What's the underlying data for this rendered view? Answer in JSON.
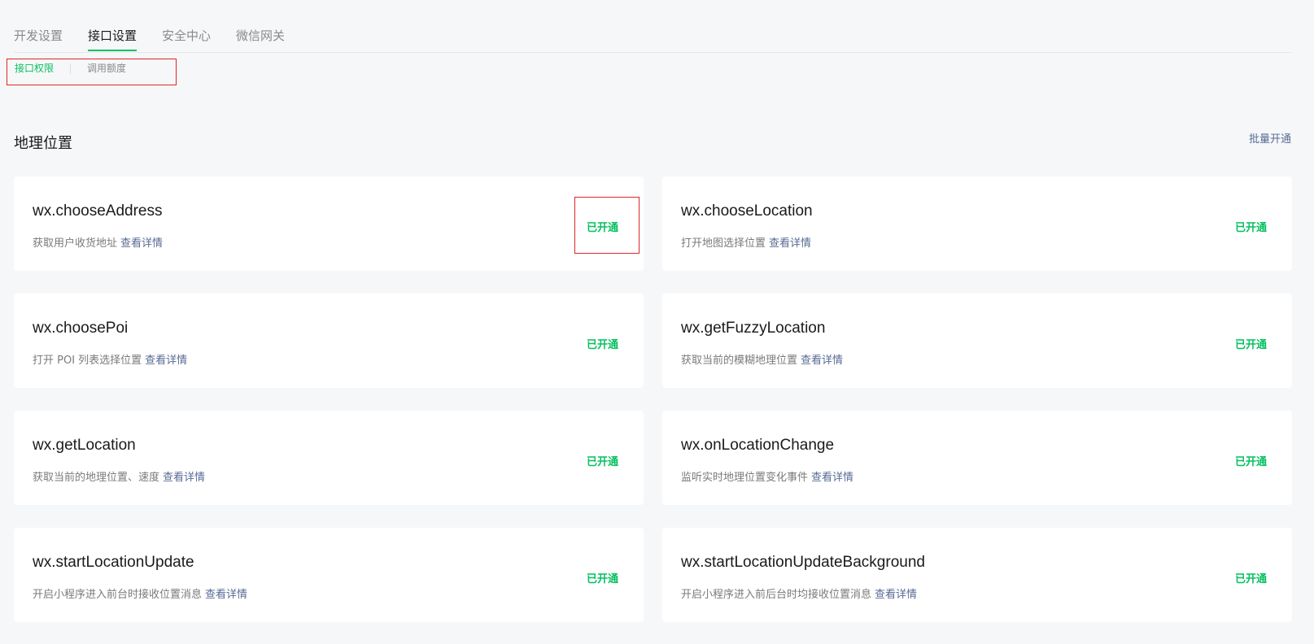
{
  "tabs": [
    "开发设置",
    "接口设置",
    "安全中心",
    "微信网关"
  ],
  "active_tab_index": 1,
  "subtabs": [
    "接口权限",
    "调用额度"
  ],
  "active_subtab_index": 0,
  "section": {
    "title": "地理位置",
    "batch_label": "批量开通"
  },
  "detail_label": "查看详情",
  "apis": [
    {
      "name": "wx.chooseAddress",
      "desc": "获取用户收货地址",
      "status": "已开通"
    },
    {
      "name": "wx.chooseLocation",
      "desc": "打开地图选择位置",
      "status": "已开通"
    },
    {
      "name": "wx.choosePoi",
      "desc": "打开 POI 列表选择位置",
      "status": "已开通"
    },
    {
      "name": "wx.getFuzzyLocation",
      "desc": "获取当前的模糊地理位置",
      "status": "已开通"
    },
    {
      "name": "wx.getLocation",
      "desc": "获取当前的地理位置、速度",
      "status": "已开通"
    },
    {
      "name": "wx.onLocationChange",
      "desc": "监听实时地理位置变化事件",
      "status": "已开通"
    },
    {
      "name": "wx.startLocationUpdate",
      "desc": "开启小程序进入前台时接收位置消息",
      "status": "已开通"
    },
    {
      "name": "wx.startLocationUpdateBackground",
      "desc": "开启小程序进入前后台时均接收位置消息",
      "status": "已开通"
    }
  ],
  "colors": {
    "accent": "#07c160",
    "link": "#576b95",
    "highlight": "#e0262a",
    "background": "#f6f7f9"
  }
}
